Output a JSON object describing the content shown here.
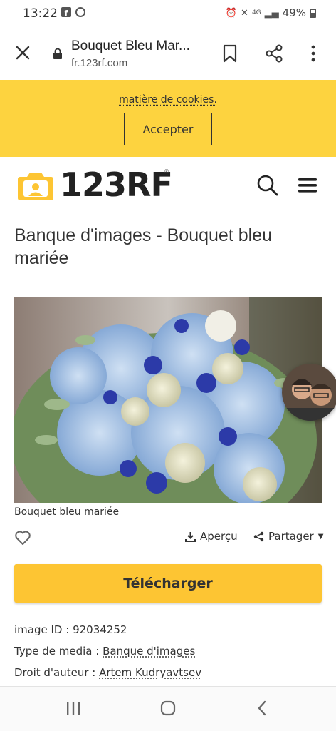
{
  "status_bar": {
    "time": "13:22",
    "network": "4G",
    "battery": "49%"
  },
  "browser": {
    "title": "Bouquet Bleu Mar...",
    "url": "fr.123rf.com"
  },
  "cookie_banner": {
    "text": "matière de cookies.",
    "accept_label": "Accepter",
    "color": "#fdd33f"
  },
  "site": {
    "logo_text": "123RF",
    "logo_reg": "®",
    "accent": "#fdc533"
  },
  "page": {
    "title": "Banque d'images - Bouquet bleu mariée",
    "caption": "Bouquet bleu mariée"
  },
  "actions": {
    "apercu": "Aperçu",
    "partager": "Partager",
    "download": "Télécharger"
  },
  "meta": {
    "image_id_label": "image ID :",
    "image_id": "92034252",
    "media_label": "Type de media :",
    "media_value": "Banque d'images",
    "author_label": "Droit d'auteur :",
    "author_value": "Artem Kudryavtsev"
  }
}
